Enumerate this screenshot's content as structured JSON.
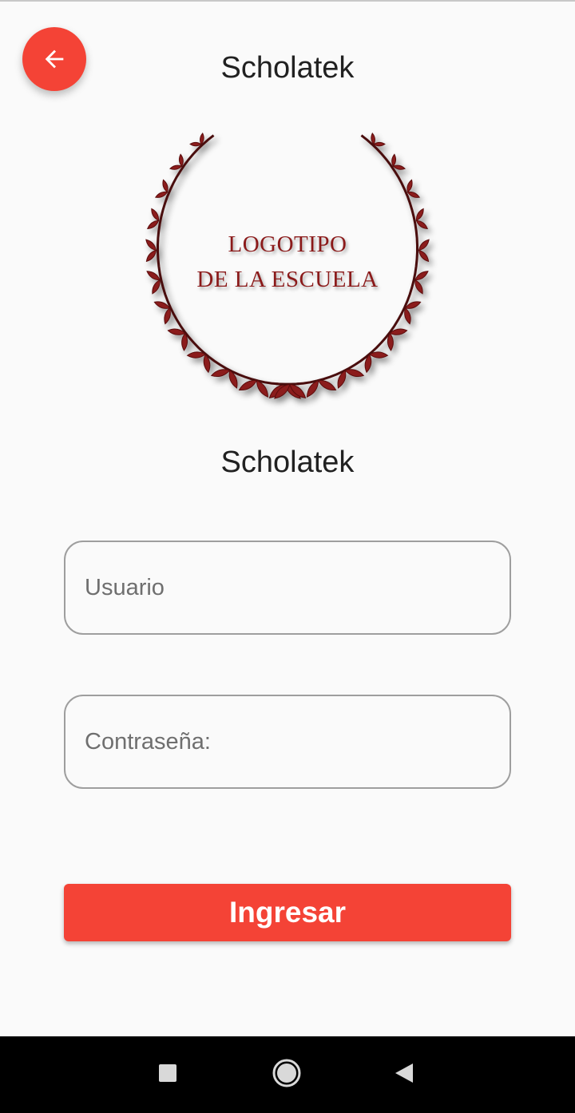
{
  "header": {
    "back_icon": "arrow-left-icon",
    "title": "Scholatek"
  },
  "logo": {
    "line1": "LOGOTIPO",
    "line2": "DE LA ESCUELA",
    "color": "#8b1a1a"
  },
  "school_name": "Scholatek",
  "form": {
    "username_placeholder": "Usuario",
    "username_value": "",
    "password_placeholder": "Contraseña:",
    "password_value": "",
    "submit_label": "Ingresar"
  },
  "nav_bar": {
    "recents_icon": "square-icon",
    "home_icon": "circle-icon",
    "back_icon": "triangle-back-icon"
  },
  "colors": {
    "accent": "#f44336",
    "background": "#fafafa",
    "text": "#212121",
    "nav_bar": "#000000"
  }
}
